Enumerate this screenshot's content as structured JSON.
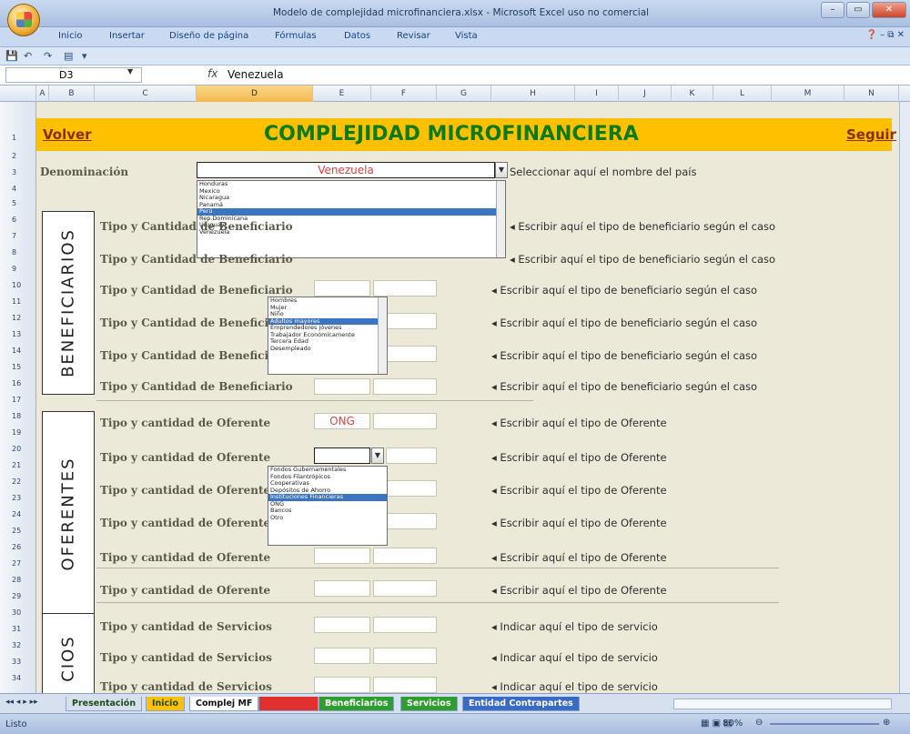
{
  "window": {
    "title": "Modelo de complejidad microfinanciera.xlsx - Microsoft Excel uso no comercial",
    "controls": [
      "–",
      "▭",
      "✕"
    ]
  },
  "ribbon": {
    "tabs": [
      "Inicio",
      "Insertar",
      "Diseño de página",
      "Fórmulas",
      "Datos",
      "Revisar",
      "Vista"
    ]
  },
  "formula_bar": {
    "cell_ref": "D3",
    "fx": "fx",
    "value": "Venezuela"
  },
  "columns": [
    "A",
    "B",
    "C",
    "D",
    "E",
    "F",
    "G",
    "H",
    "I",
    "J",
    "K",
    "L",
    "M",
    "N"
  ],
  "rows": [
    "1",
    "2",
    "3",
    "4",
    "5",
    "6",
    "7",
    "8",
    "9",
    "10",
    "11",
    "12",
    "13",
    "14",
    "15",
    "16",
    "17",
    "18",
    "19",
    "20",
    "21",
    "22",
    "23",
    "24",
    "25",
    "26",
    "27",
    "28",
    "29",
    "30",
    "31",
    "32",
    "33",
    "34"
  ],
  "sheet": {
    "nav_prev": "Volver",
    "nav_next": "Seguir",
    "title": "COMPLEJIDAD MICROFINANCIERA",
    "denominacion": {
      "label": "Denominación",
      "value": "Venezuela",
      "hint": "Seleccionar aquí el nombre del país"
    },
    "country_list": [
      "Honduras",
      "Mexico",
      "Nicaragua",
      "Panamá",
      "Perú",
      "Rep.Dominicana",
      "Uruguay",
      "Venezuela"
    ],
    "beneficiarios": {
      "section": "BENEFICIARIOS",
      "rows": [
        {
          "label": "Tipo y Cantidad de Beneficiario",
          "hint": "◂ Escribir aquí el tipo de beneficiario según el caso"
        },
        {
          "label": "Tipo y Cantidad de Beneficiario",
          "hint": "◂ Escribir aquí el tipo de beneficiario según el caso"
        },
        {
          "label": "Tipo y Cantidad de Beneficiario",
          "hint": "◂ Escribir aquí el tipo de beneficiario según el caso"
        },
        {
          "label": "Tipo y Cantidad de Beneficiario",
          "hint": "◂ Escribir aquí el tipo de beneficiario según el caso"
        },
        {
          "label": "Tipo y Cantidad de Beneficiario",
          "hint": "◂ Escribir aquí el tipo de beneficiario según el caso"
        },
        {
          "label": "Tipo y Cantidad de Beneficiario",
          "hint": "◂ Escribir aquí el tipo de beneficiario según el caso"
        }
      ],
      "dropdown": [
        "Hombres",
        "Mujer",
        "Niño",
        "Adultos mayores",
        "Emprendedores jóvenes",
        "Trabajador Económicamente",
        "Tercera Edad",
        "Desempleado"
      ]
    },
    "oferentes": {
      "section": "OFERENTES",
      "rows": [
        {
          "label": "Tipo y cantidad de Oferente",
          "value": "ONG",
          "hint": "◂ Escribir aquí el tipo de Oferente"
        },
        {
          "label": "Tipo y cantidad de Oferente",
          "value": "",
          "hint": "◂ Escribir aquí el tipo de Oferente"
        },
        {
          "label": "Tipo y cantidad de Oferente",
          "value": "",
          "hint": "◂ Escribir aquí el tipo de Oferente"
        },
        {
          "label": "Tipo y cantidad de Oferente",
          "value": "",
          "hint": "◂ Escribir aquí el tipo de Oferente"
        },
        {
          "label": "Tipo y cantidad de Oferente",
          "value": "",
          "hint": "◂ Escribir aquí el tipo de Oferente"
        },
        {
          "label": "Tipo y cantidad de Oferente",
          "value": "",
          "hint": "◂ Escribir aquí el tipo de Oferente"
        }
      ],
      "dropdown": [
        "Fondos Gubernamentales",
        "Fondos Filantrópicos",
        "Cooperativas",
        "Depósitos de Ahorro",
        "Instituciones Financieras",
        "ONG",
        "Bancos",
        "Otro"
      ]
    },
    "servicios": {
      "section": "CIOS",
      "rows": [
        {
          "label": "Tipo y cantidad de Servicios",
          "hint": "◂ Indicar aquí el tipo de servicio"
        },
        {
          "label": "Tipo y cantidad de Servicios",
          "hint": "◂ Indicar aquí el tipo de servicio"
        },
        {
          "label": "Tipo y cantidad de Servicios",
          "hint": "◂ Indicar aquí el tipo de servicio"
        }
      ]
    }
  },
  "sheet_tabs": [
    {
      "label": "Presentación",
      "color": "#d6e0ef"
    },
    {
      "label": "Inicio",
      "color": "#ffc000"
    },
    {
      "label": "Complej MF",
      "color": "#ffffff"
    },
    {
      "label": "",
      "color": "#e03030"
    },
    {
      "label": "Beneficiarios",
      "color": "#2e9e2e"
    },
    {
      "label": "Servicios",
      "color": "#2e9e2e"
    },
    {
      "label": "Entidad Contrapartes",
      "color": "#3a6bc4"
    }
  ],
  "status": {
    "text": "Listo",
    "zoom": "80%"
  }
}
